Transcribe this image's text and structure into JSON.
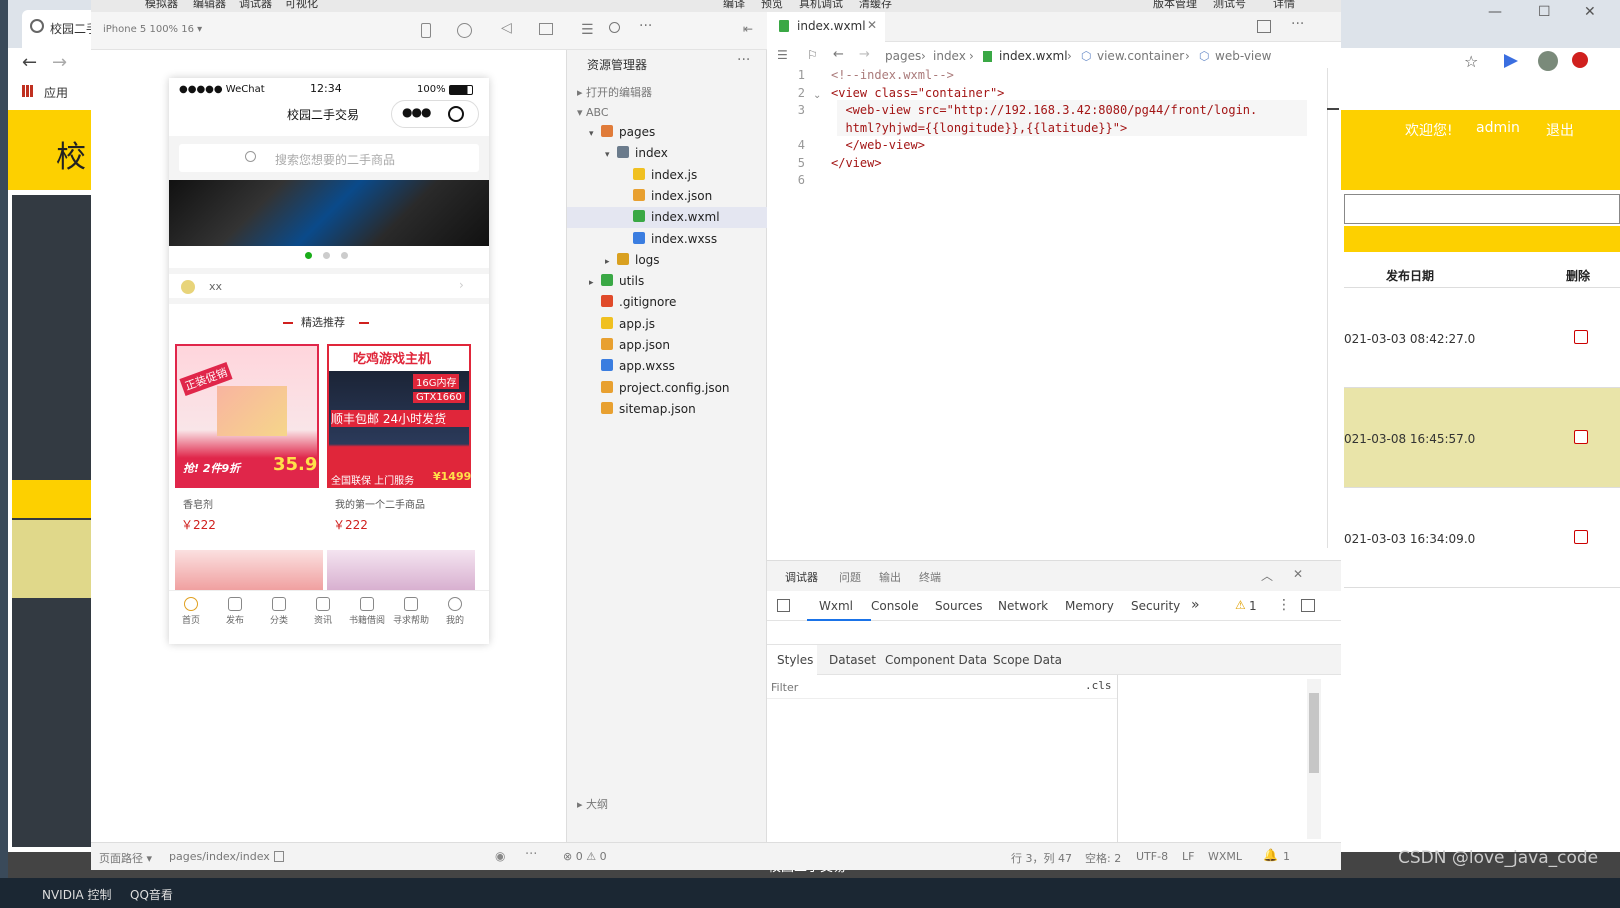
{
  "bg_browser": {
    "tab_title": "校园二手",
    "bookmarks_label": "应用",
    "site_logo_char": "校",
    "welcome": "欢迎您!",
    "user": "admin",
    "logout": "退出",
    "table_headers": [
      "发布日期",
      "删除"
    ],
    "rows": [
      {
        "date": "021-03-03 08:42:27.0",
        "highlight": false
      },
      {
        "date": "021-03-08 16:45:57.0",
        "highlight": true
      },
      {
        "date": "021-03-03 16:34:09.0",
        "highlight": false
      }
    ],
    "footer_text": "校园二手交易"
  },
  "taskbar": {
    "items": [
      "NVIDIA 控制",
      "QQ音看"
    ],
    "watermark": "CSDN @love_java_code"
  },
  "devtools": {
    "menu": [
      "模拟器",
      "编辑器",
      "调试器",
      "可视化",
      "编译",
      "预览",
      "真机调试",
      "清缓存",
      "版本管理",
      "测试号",
      "详情"
    ],
    "device_label": "iPhone 5 100% 16 ▾",
    "explorer": {
      "title": "资源管理器",
      "open_editors": "打开的编辑器",
      "project": "ABC",
      "outline": "大纲",
      "tree": [
        {
          "label": "pages",
          "level": 1,
          "type": "folder",
          "arrow": "▾",
          "color": "#e07b39"
        },
        {
          "label": "index",
          "level": 2,
          "type": "folder",
          "arrow": "▾",
          "color": "#6b7b8c"
        },
        {
          "label": "index.js",
          "level": 3,
          "type": "js",
          "arrow": "",
          "color": "#f0c020"
        },
        {
          "label": "index.json",
          "level": 3,
          "type": "json",
          "arrow": "",
          "color": "#e8a030"
        },
        {
          "label": "index.wxml",
          "level": 3,
          "type": "wxml",
          "arrow": "",
          "color": "#3aa845",
          "selected": true
        },
        {
          "label": "index.wxss",
          "level": 3,
          "type": "wxss",
          "arrow": "",
          "color": "#3a7de0"
        },
        {
          "label": "logs",
          "level": 2,
          "type": "folder",
          "arrow": "▸",
          "color": "#d9a020"
        },
        {
          "label": "utils",
          "level": 1,
          "type": "folder",
          "arrow": "▸",
          "color": "#3aa845"
        },
        {
          "label": ".gitignore",
          "level": 1,
          "type": "git",
          "arrow": "",
          "color": "#e04a2a"
        },
        {
          "label": "app.js",
          "level": 1,
          "type": "js",
          "arrow": "",
          "color": "#f0c020"
        },
        {
          "label": "app.json",
          "level": 1,
          "type": "json",
          "arrow": "",
          "color": "#e8a030"
        },
        {
          "label": "app.wxss",
          "level": 1,
          "type": "wxss",
          "arrow": "",
          "color": "#3a7de0"
        },
        {
          "label": "project.config.json",
          "level": 1,
          "type": "json",
          "arrow": "",
          "color": "#e8a030"
        },
        {
          "label": "sitemap.json",
          "level": 1,
          "type": "json",
          "arrow": "",
          "color": "#e8a030"
        }
      ]
    },
    "editor": {
      "tab": "index.wxml",
      "breadcrumb": [
        "pages",
        "index",
        "index.wxml",
        "view.container",
        "web-view"
      ],
      "line_numbers": [
        "1",
        "2",
        "3",
        "",
        "4",
        "5",
        "6"
      ],
      "lines": [
        "<!--index.wxml-->",
        "<view class=\"container\">",
        "  <web-view src=\"http://192.168.3.42:8080/pg44/front/login.",
        "  html?yhjwd={{longitude}},{{latitude}}\">",
        "  </web-view>",
        "</view>",
        ""
      ]
    },
    "debugger": {
      "top_tabs": [
        "调试器",
        "问题",
        "输出",
        "终端"
      ],
      "tabs": [
        "Wxml",
        "Console",
        "Sources",
        "Network",
        "Memory",
        "Security",
        "»"
      ],
      "warning_count": "1",
      "sub_tabs": [
        "Styles",
        "Dataset",
        "Component Data",
        "Scope Data"
      ],
      "filter_placeholder": "Filter",
      "cls": ".cls"
    },
    "statusbar": {
      "page_path_label": "页面路径 ▾",
      "page_path": "pages/index/index",
      "errors": "⊗ 0 ⚠ 0",
      "position": "行 3，列 47",
      "spaces": "空格: 2",
      "encoding": "UTF-8",
      "eol": "LF",
      "lang": "WXML",
      "bell": "1"
    }
  },
  "phone": {
    "carrier": "●●●●● WeChat",
    "time": "12:34",
    "battery": "100%",
    "title": "校园二手交易",
    "search_placeholder": "搜索您想要的二手商品",
    "notice": "xx",
    "section_title": "精选推荐",
    "products": [
      {
        "name": "香皂剂",
        "price": "￥222",
        "ad_top": "吃鸡游戏主机"
      },
      {
        "name": "我的第一个二手商品",
        "price": "￥222",
        "ad_top": "吃鸡游戏主机"
      }
    ],
    "ad1_text": [
      "正装促销",
      "抢! 2件9折",
      "35.9"
    ],
    "ad2_text": [
      "吃鸡游戏主机",
      "16G内存",
      "GTX1660",
      "顺丰包邮 24小时发货",
      "全国联保 上门服务",
      "¥1499"
    ],
    "nav": [
      "首页",
      "发布",
      "分类",
      "资讯",
      "书籍借阅",
      "寻求帮助",
      "我的"
    ]
  }
}
